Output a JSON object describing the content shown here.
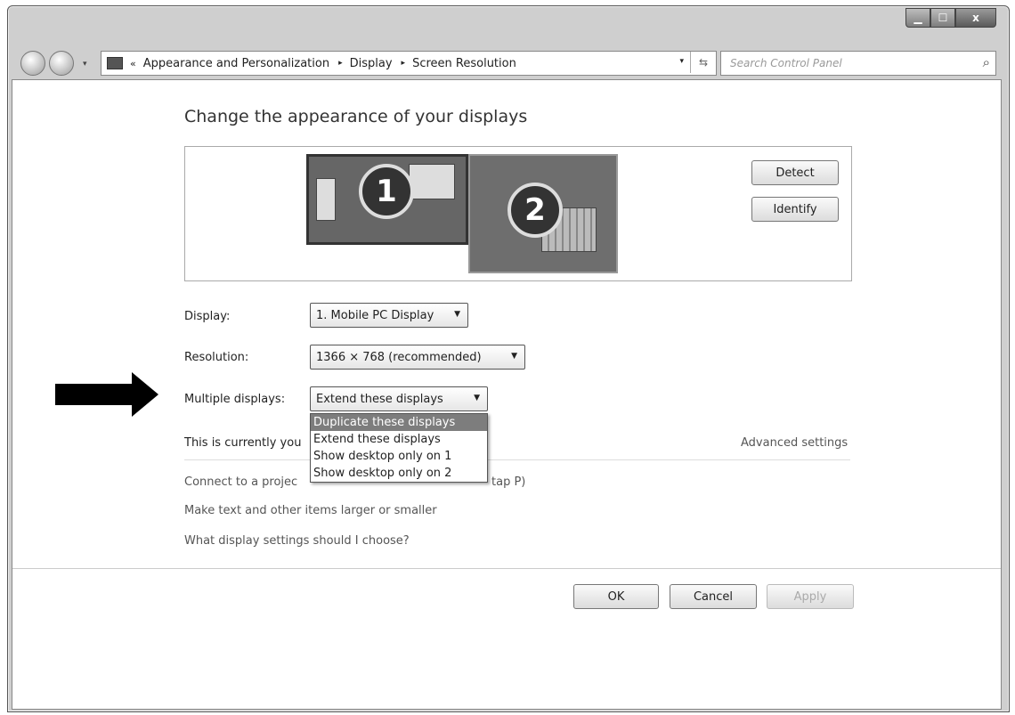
{
  "window": {
    "controls": {
      "minimize": "▁",
      "maximize": "☐",
      "close": "x"
    }
  },
  "address_bar": {
    "chevron": "«",
    "crumbs": [
      "Appearance and Personalization",
      "Display",
      "Screen Resolution"
    ],
    "separator": "▸",
    "refresh_icon": "⇆",
    "dropdown_icon": "▾"
  },
  "search": {
    "placeholder": "Search Control Panel",
    "icon": "⌕"
  },
  "page": {
    "title": "Change the appearance of your displays",
    "monitors": [
      "1",
      "2"
    ],
    "detect_label": "Detect",
    "identify_label": "Identify",
    "display": {
      "label": "Display:",
      "value": "1. Mobile PC Display"
    },
    "resolution": {
      "label": "Resolution:",
      "value": "1366 × 768 (recommended)"
    },
    "multiple": {
      "label": "Multiple displays:",
      "value": "Extend these displays",
      "options": [
        "Duplicate these displays",
        "Extend these displays",
        "Show desktop only on 1",
        "Show desktop only on 2"
      ],
      "selected_index": 0
    },
    "currently_text": "This is currently you",
    "advanced_link": "Advanced settings",
    "connect_text_left": "Connect to a projec",
    "connect_text_right": "tap P)",
    "links": [
      "Make text and other items larger or smaller",
      "What display settings should I choose?"
    ],
    "ok_label": "OK",
    "cancel_label": "Cancel",
    "apply_label": "Apply"
  }
}
